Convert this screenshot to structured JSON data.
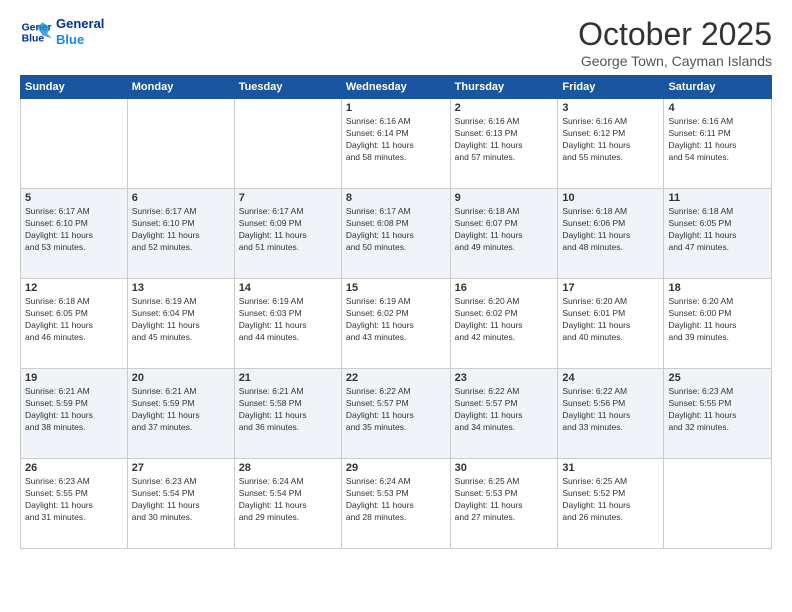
{
  "header": {
    "logo_line1": "General",
    "logo_line2": "Blue",
    "month_title": "October 2025",
    "subtitle": "George Town, Cayman Islands"
  },
  "days_of_week": [
    "Sunday",
    "Monday",
    "Tuesday",
    "Wednesday",
    "Thursday",
    "Friday",
    "Saturday"
  ],
  "weeks": [
    [
      {
        "num": "",
        "info": ""
      },
      {
        "num": "",
        "info": ""
      },
      {
        "num": "",
        "info": ""
      },
      {
        "num": "1",
        "info": "Sunrise: 6:16 AM\nSunset: 6:14 PM\nDaylight: 11 hours\nand 58 minutes."
      },
      {
        "num": "2",
        "info": "Sunrise: 6:16 AM\nSunset: 6:13 PM\nDaylight: 11 hours\nand 57 minutes."
      },
      {
        "num": "3",
        "info": "Sunrise: 6:16 AM\nSunset: 6:12 PM\nDaylight: 11 hours\nand 55 minutes."
      },
      {
        "num": "4",
        "info": "Sunrise: 6:16 AM\nSunset: 6:11 PM\nDaylight: 11 hours\nand 54 minutes."
      }
    ],
    [
      {
        "num": "5",
        "info": "Sunrise: 6:17 AM\nSunset: 6:10 PM\nDaylight: 11 hours\nand 53 minutes."
      },
      {
        "num": "6",
        "info": "Sunrise: 6:17 AM\nSunset: 6:10 PM\nDaylight: 11 hours\nand 52 minutes."
      },
      {
        "num": "7",
        "info": "Sunrise: 6:17 AM\nSunset: 6:09 PM\nDaylight: 11 hours\nand 51 minutes."
      },
      {
        "num": "8",
        "info": "Sunrise: 6:17 AM\nSunset: 6:08 PM\nDaylight: 11 hours\nand 50 minutes."
      },
      {
        "num": "9",
        "info": "Sunrise: 6:18 AM\nSunset: 6:07 PM\nDaylight: 11 hours\nand 49 minutes."
      },
      {
        "num": "10",
        "info": "Sunrise: 6:18 AM\nSunset: 6:06 PM\nDaylight: 11 hours\nand 48 minutes."
      },
      {
        "num": "11",
        "info": "Sunrise: 6:18 AM\nSunset: 6:05 PM\nDaylight: 11 hours\nand 47 minutes."
      }
    ],
    [
      {
        "num": "12",
        "info": "Sunrise: 6:18 AM\nSunset: 6:05 PM\nDaylight: 11 hours\nand 46 minutes."
      },
      {
        "num": "13",
        "info": "Sunrise: 6:19 AM\nSunset: 6:04 PM\nDaylight: 11 hours\nand 45 minutes."
      },
      {
        "num": "14",
        "info": "Sunrise: 6:19 AM\nSunset: 6:03 PM\nDaylight: 11 hours\nand 44 minutes."
      },
      {
        "num": "15",
        "info": "Sunrise: 6:19 AM\nSunset: 6:02 PM\nDaylight: 11 hours\nand 43 minutes."
      },
      {
        "num": "16",
        "info": "Sunrise: 6:20 AM\nSunset: 6:02 PM\nDaylight: 11 hours\nand 42 minutes."
      },
      {
        "num": "17",
        "info": "Sunrise: 6:20 AM\nSunset: 6:01 PM\nDaylight: 11 hours\nand 40 minutes."
      },
      {
        "num": "18",
        "info": "Sunrise: 6:20 AM\nSunset: 6:00 PM\nDaylight: 11 hours\nand 39 minutes."
      }
    ],
    [
      {
        "num": "19",
        "info": "Sunrise: 6:21 AM\nSunset: 5:59 PM\nDaylight: 11 hours\nand 38 minutes."
      },
      {
        "num": "20",
        "info": "Sunrise: 6:21 AM\nSunset: 5:59 PM\nDaylight: 11 hours\nand 37 minutes."
      },
      {
        "num": "21",
        "info": "Sunrise: 6:21 AM\nSunset: 5:58 PM\nDaylight: 11 hours\nand 36 minutes."
      },
      {
        "num": "22",
        "info": "Sunrise: 6:22 AM\nSunset: 5:57 PM\nDaylight: 11 hours\nand 35 minutes."
      },
      {
        "num": "23",
        "info": "Sunrise: 6:22 AM\nSunset: 5:57 PM\nDaylight: 11 hours\nand 34 minutes."
      },
      {
        "num": "24",
        "info": "Sunrise: 6:22 AM\nSunset: 5:56 PM\nDaylight: 11 hours\nand 33 minutes."
      },
      {
        "num": "25",
        "info": "Sunrise: 6:23 AM\nSunset: 5:55 PM\nDaylight: 11 hours\nand 32 minutes."
      }
    ],
    [
      {
        "num": "26",
        "info": "Sunrise: 6:23 AM\nSunset: 5:55 PM\nDaylight: 11 hours\nand 31 minutes."
      },
      {
        "num": "27",
        "info": "Sunrise: 6:23 AM\nSunset: 5:54 PM\nDaylight: 11 hours\nand 30 minutes."
      },
      {
        "num": "28",
        "info": "Sunrise: 6:24 AM\nSunset: 5:54 PM\nDaylight: 11 hours\nand 29 minutes."
      },
      {
        "num": "29",
        "info": "Sunrise: 6:24 AM\nSunset: 5:53 PM\nDaylight: 11 hours\nand 28 minutes."
      },
      {
        "num": "30",
        "info": "Sunrise: 6:25 AM\nSunset: 5:53 PM\nDaylight: 11 hours\nand 27 minutes."
      },
      {
        "num": "31",
        "info": "Sunrise: 6:25 AM\nSunset: 5:52 PM\nDaylight: 11 hours\nand 26 minutes."
      },
      {
        "num": "",
        "info": ""
      }
    ]
  ]
}
